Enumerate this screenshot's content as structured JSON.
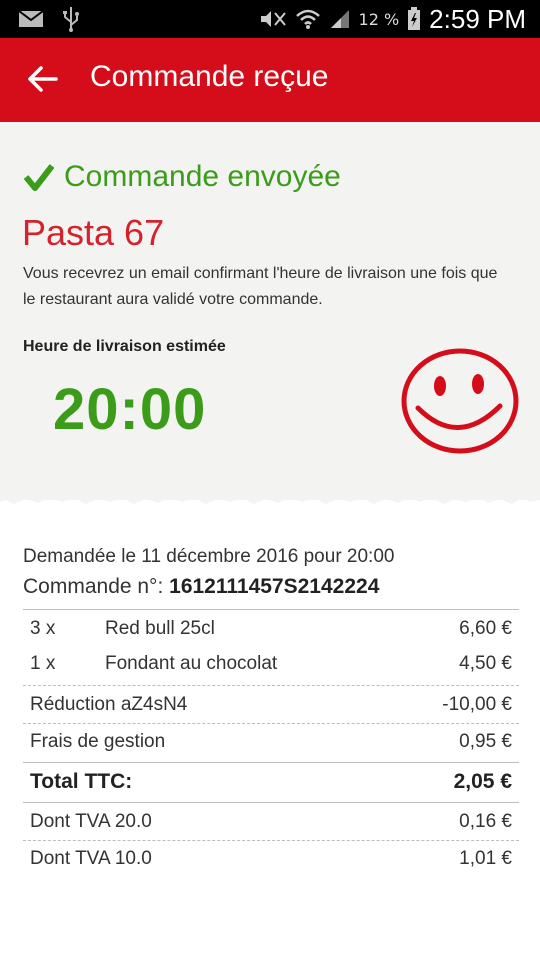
{
  "status_bar": {
    "battery": "12 %",
    "time": "2:59 PM",
    "icons": [
      "mail-icon",
      "usb-icon",
      "mute-icon",
      "wifi-icon",
      "signal-icon",
      "battery-icon"
    ]
  },
  "app_bar": {
    "title": "Commande reçue",
    "back_icon": "arrow-back-icon",
    "color": "#d50d1a"
  },
  "confirmation": {
    "check_icon": "check-icon",
    "status_text": "Commande envoyée",
    "restaurant": "Pasta 67",
    "info_text": "Vous recevrez un email confirmant l'heure de livraison une fois que le restaurant aura validé votre commande.",
    "eta_label": "Heure de livraison estimée",
    "eta_time": "20:00",
    "smiley_icon": "smiley-icon"
  },
  "receipt": {
    "requested": "Demandée le 11 décembre 2016 pour 20:00",
    "order_label": "Commande n°: ",
    "order_number": "1612111457S2142224",
    "items": [
      {
        "qty": "3 x",
        "name": "Red bull 25cl",
        "amount": "6,60 €"
      },
      {
        "qty": "1 x",
        "name": "Fondant au chocolat",
        "amount": "4,50 €"
      }
    ],
    "discount": {
      "label": "Réduction aZ4sN4",
      "amount": "-10,00 €"
    },
    "fees": {
      "label": "Frais de gestion",
      "amount": "0,95 €"
    },
    "total": {
      "label": "Total TTC:",
      "amount": "2,05 €"
    },
    "taxes": [
      {
        "label": "Dont TVA 20.0",
        "amount": "0,16 €"
      },
      {
        "label": "Dont TVA 10.0",
        "amount": "1,01 €"
      }
    ]
  },
  "colors": {
    "accent_red": "#d50d1a",
    "success_green": "#3b9c1a",
    "restaurant_red": "#d3232c"
  }
}
